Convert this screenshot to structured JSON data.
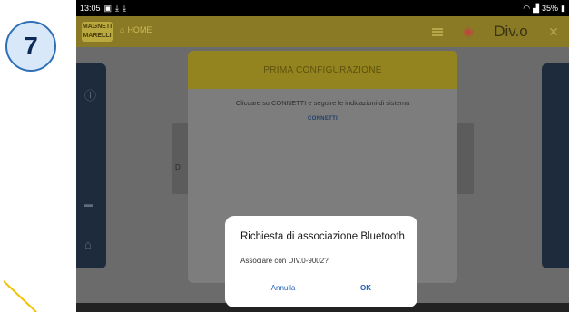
{
  "step_badge": "7",
  "status_bar": {
    "time": "13:05",
    "battery": "35%"
  },
  "toolbar": {
    "logo": "MAGNETI MARELLI",
    "home": "HOME",
    "brand": "Div.o"
  },
  "config_dialog": {
    "title": "PRIMA CONFIGURAZIONE",
    "instruction": "Cliccare su CONNETTI e seguire le indicazioni di sistema",
    "connect": "CONNETTI"
  },
  "background": {
    "card_letter": "D"
  },
  "bt_dialog": {
    "title": "Richiesta di associazione Bluetooth",
    "message": "Associare con DIV.0-9002?",
    "cancel": "Annulla",
    "ok": "OK"
  },
  "colors": {
    "accent": "#1f5fb7",
    "toolbar": "#8a7a25",
    "header": "#93841f",
    "badge": "#2f6fb7"
  }
}
